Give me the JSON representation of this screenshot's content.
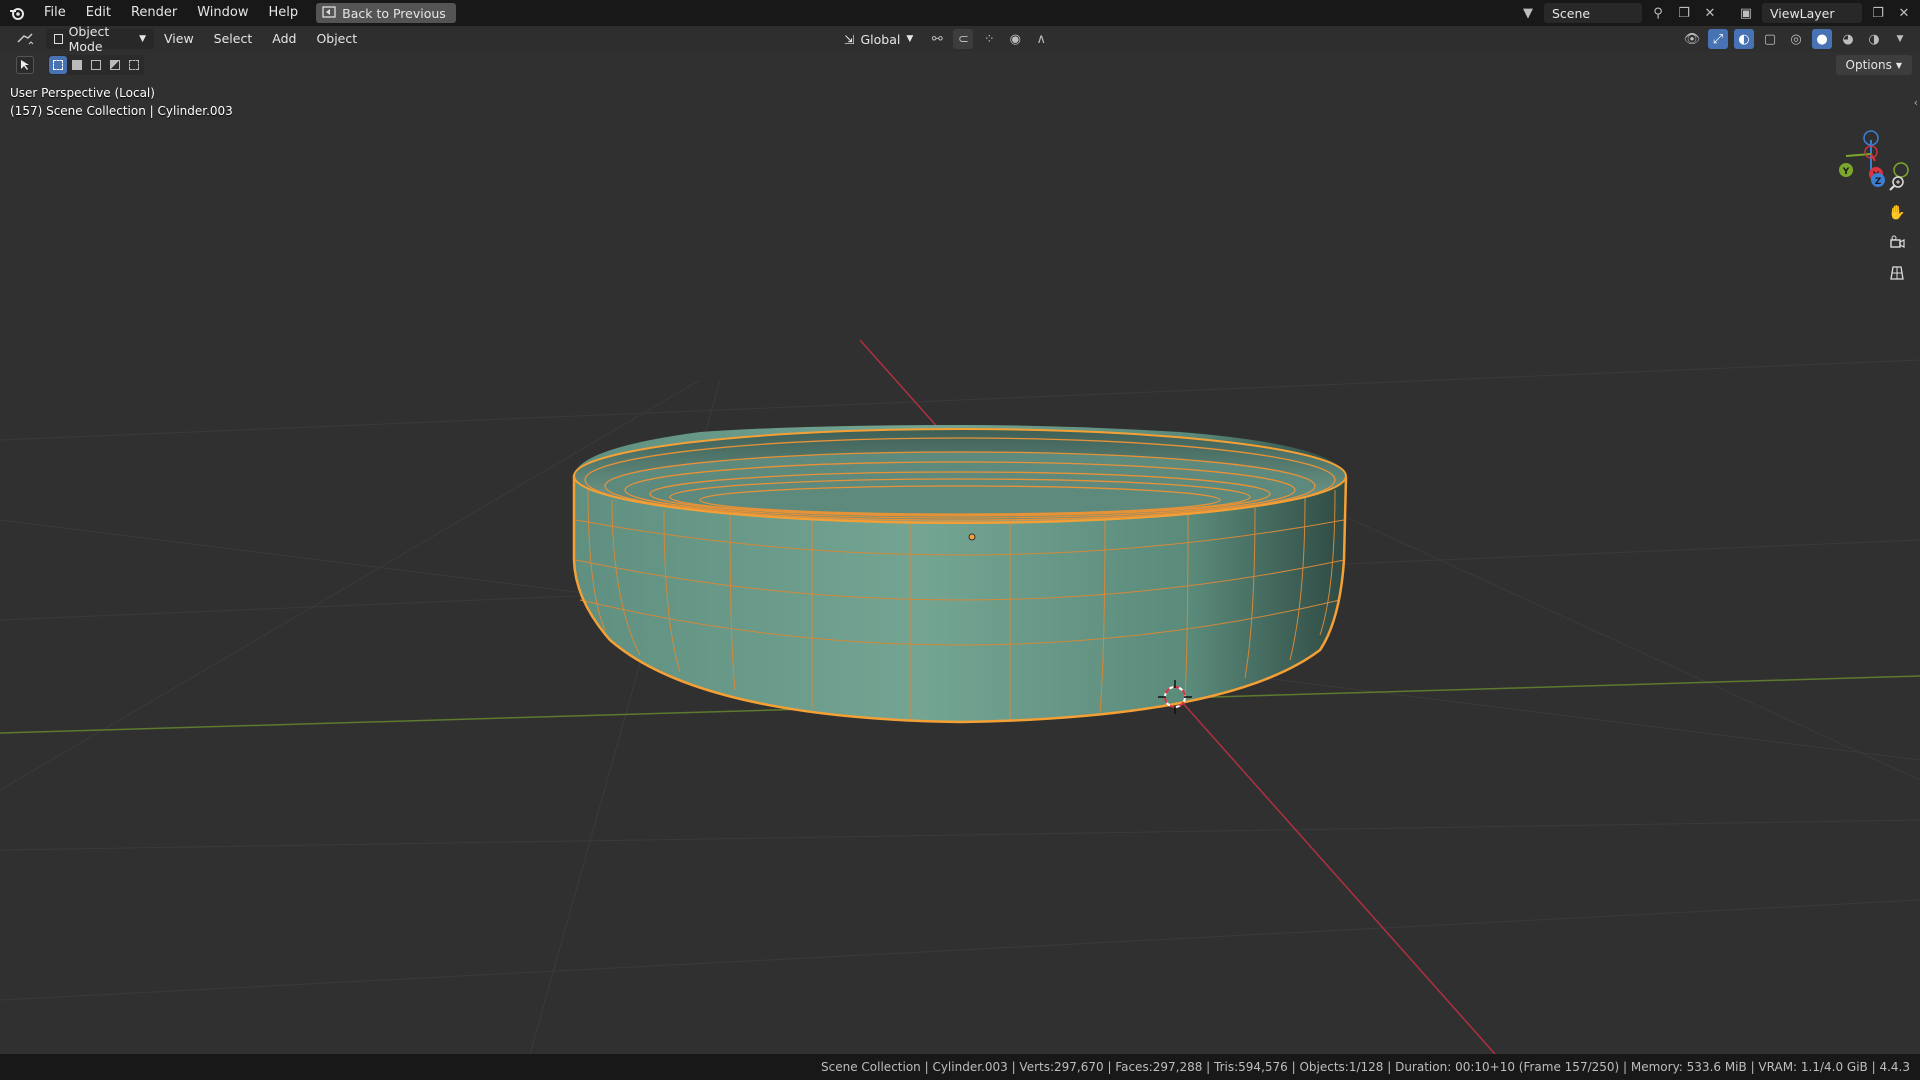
{
  "topbar": {
    "menus": [
      "File",
      "Edit",
      "Render",
      "Window",
      "Help"
    ],
    "back_label": "Back to Previous",
    "scene_name": "Scene",
    "view_layer": "ViewLayer"
  },
  "header": {
    "mode": "Object Mode",
    "menus": [
      "View",
      "Select",
      "Add",
      "Object"
    ],
    "orientation": "Global"
  },
  "toolbar": {
    "options_label": "Options"
  },
  "viewport": {
    "perspective_label": "User Perspective (Local)",
    "collection_label": "(157) Scene Collection | Cylinder.003",
    "gizmo": {
      "x": "X",
      "y": "Y",
      "z": "Z"
    },
    "colors": {
      "selection": "#f5a035",
      "mesh": "#6fa08f",
      "x_axis": "#d9343f",
      "y_axis": "#7ba82c"
    }
  },
  "statusbar": {
    "text": "Scene Collection | Cylinder.003 | Verts:297,670 | Faces:297,288 | Tris:594,576 | Objects:1/128 | Duration: 00:10+10 (Frame 157/250) | Memory: 533.6 MiB | VRAM: 1.1/4.0 GiB | 4.4.3"
  }
}
